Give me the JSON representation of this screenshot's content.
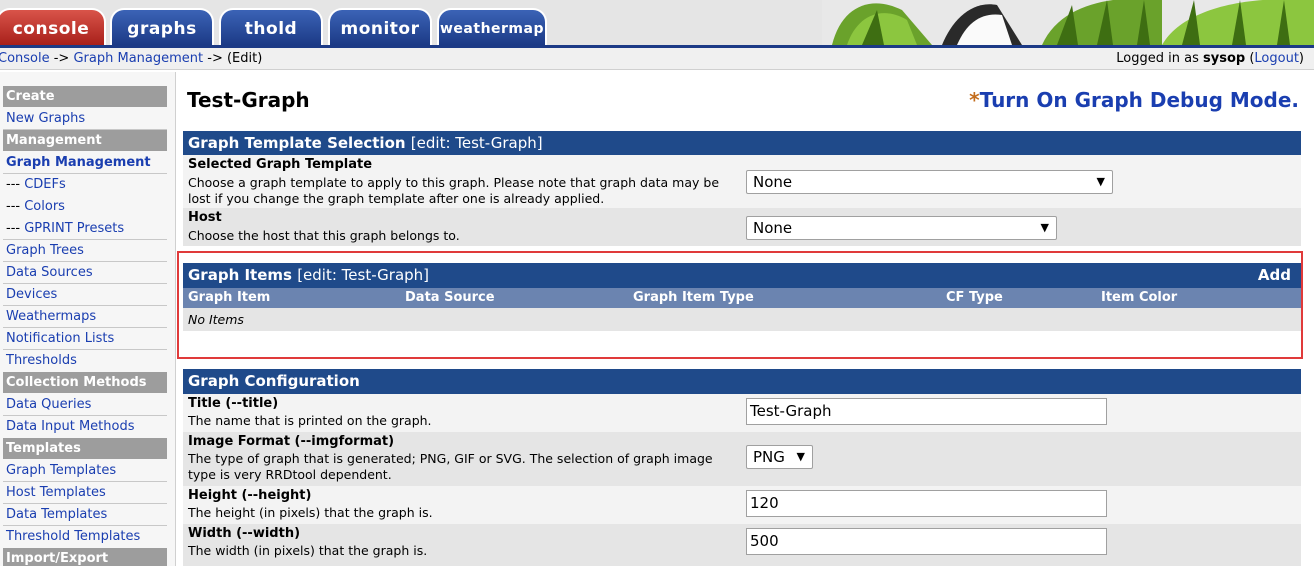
{
  "tabs": [
    {
      "id": "console",
      "label": "console"
    },
    {
      "id": "graphs",
      "label": "graphs"
    },
    {
      "id": "thold",
      "label": "thold"
    },
    {
      "id": "monitor",
      "label": "monitor"
    },
    {
      "id": "weathermap",
      "label": "weathermap"
    }
  ],
  "breadcrumb": {
    "console": "Console",
    "sep1": " -> ",
    "graph_management": "Graph Management",
    "sep2": " -> ",
    "current": "(Edit)"
  },
  "login": {
    "prefix": "Logged in as ",
    "user": "sysop",
    "logout": "Logout"
  },
  "menu": {
    "create_head": "Create",
    "new_graphs": "New Graphs",
    "management_head": "Management",
    "graph_management": "Graph Management",
    "cdefs": "CDEFs",
    "colors": "Colors",
    "gprint": "GPRINT Presets",
    "graph_trees": "Graph Trees",
    "data_sources": "Data Sources",
    "devices": "Devices",
    "weathermaps": "Weathermaps",
    "notification_lists": "Notification Lists",
    "thresholds": "Thresholds",
    "collection_head": "Collection Methods",
    "data_queries": "Data Queries",
    "data_input_methods": "Data Input Methods",
    "templates_head": "Templates",
    "graph_templates": "Graph Templates",
    "host_templates": "Host Templates",
    "data_templates": "Data Templates",
    "threshold_templates": "Threshold Templates",
    "import_export_head": "Import/Export",
    "sub_prefix": "--- "
  },
  "page": {
    "title": "Test-Graph",
    "debug_star": "*",
    "debug_link": "Turn On Graph Debug Mode."
  },
  "template_selection": {
    "heading": "Graph Template Selection",
    "edit": "[edit: Test-Graph]",
    "template_label": "Selected Graph Template",
    "template_desc": "Choose a graph template to apply to this graph. Please note that graph data may be lost if you change the graph template after one is already applied.",
    "template_value": "None",
    "host_label": "Host",
    "host_desc": "Choose the host that this graph belongs to.",
    "host_value": "None"
  },
  "graph_items": {
    "heading": "Graph Items",
    "edit": "[edit: Test-Graph]",
    "add": "Add",
    "columns": [
      "Graph Item",
      "Data Source",
      "Graph Item Type",
      "CF Type",
      "Item Color"
    ],
    "empty": "No Items"
  },
  "config": {
    "heading": "Graph Configuration",
    "title_label": "Title (--title)",
    "title_desc": "The name that is printed on the graph.",
    "title_value": "Test-Graph",
    "format_label": "Image Format (--imgformat)",
    "format_desc": "The type of graph that is generated; PNG, GIF or SVG. The selection of graph image type is very RRDtool dependent.",
    "format_value": "PNG",
    "height_label": "Height (--height)",
    "height_desc": "The height (in pixels) that the graph is.",
    "height_value": "120",
    "width_label": "Width (--width)",
    "width_desc": "The width (in pixels) that the graph is.",
    "width_value": "500"
  },
  "colors": {
    "header_blue": "#1f4a8a",
    "subheader_blue": "#6b84b0",
    "link_blue": "#1a3eb0",
    "highlight_red": "#e03a3a",
    "menu_head_gray": "#9d9d9d"
  }
}
